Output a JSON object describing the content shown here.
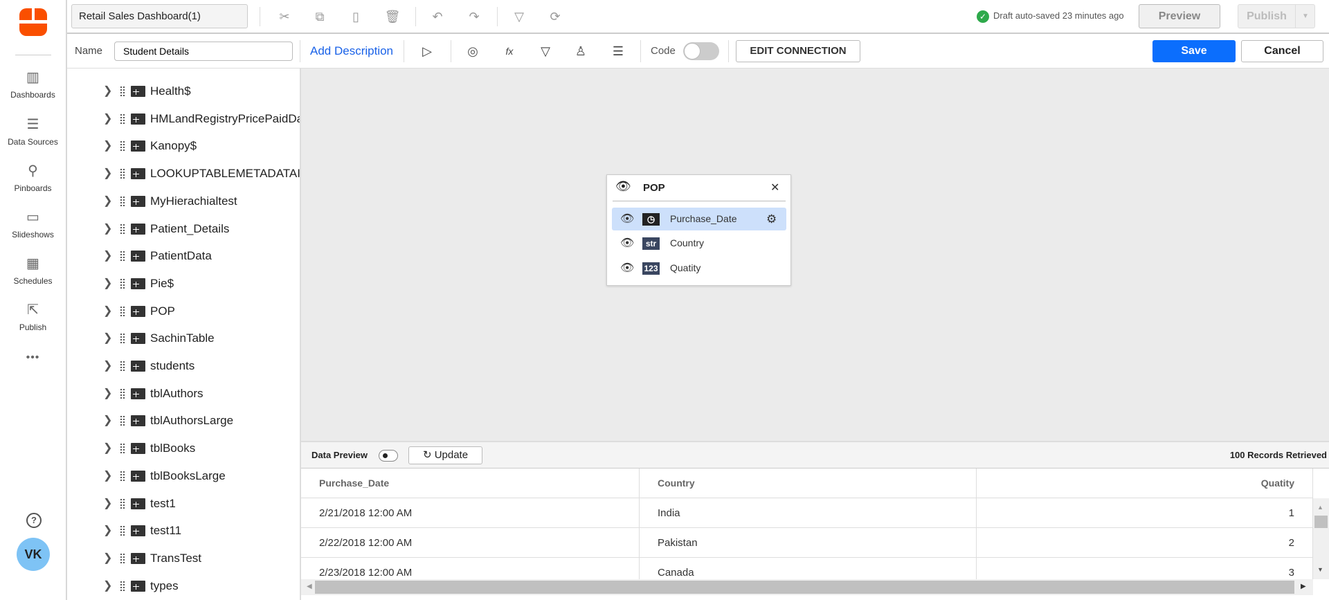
{
  "nav": {
    "items": [
      {
        "label": "Dashboards",
        "icon": "bar-chart-icon"
      },
      {
        "label": "Data Sources",
        "icon": "server-icon"
      },
      {
        "label": "Pinboards",
        "icon": "pin-icon"
      },
      {
        "label": "Slideshows",
        "icon": "tv-icon"
      },
      {
        "label": "Schedules",
        "icon": "calendar-clock-icon"
      },
      {
        "label": "Publish",
        "icon": "share-icon"
      }
    ],
    "more": "•••",
    "help": "?",
    "avatar": "VK"
  },
  "topbar": {
    "title": "Retail Sales Dashboard(1)",
    "status": "Draft auto-saved 23 minutes ago",
    "preview": "Preview",
    "publish": "Publish"
  },
  "toolbar": {
    "name_label": "Name",
    "name_value": "Student Details",
    "add_description": "Add Description",
    "code_label": "Code",
    "edit_connection": "EDIT CONNECTION",
    "save": "Save",
    "cancel": "Cancel"
  },
  "tree": {
    "items": [
      "Health$",
      "HMLandRegistryPricePaidDat",
      "Kanopy$",
      "LOOKUPTABLEMETADATAINF",
      "MyHierachialtest",
      "Patient_Details",
      "PatientData",
      "Pie$",
      "POP",
      "SachinTable",
      "students",
      "tblAuthors",
      "tblAuthorsLarge",
      "tblBooks",
      "tblBooksLarge",
      "test1",
      "test11",
      "TransTest",
      "types"
    ]
  },
  "popup": {
    "title": "POP",
    "fields": [
      {
        "type": "date",
        "badge": "",
        "name": "Purchase_Date"
      },
      {
        "type": "string",
        "badge": "str",
        "name": "Country"
      },
      {
        "type": "number",
        "badge": "123",
        "name": "Quatity"
      }
    ]
  },
  "preview": {
    "label": "Data Preview",
    "update": "Update",
    "records": "100 Records Retrieved"
  },
  "table": {
    "headers": [
      "Purchase_Date",
      "Country",
      "Quatity"
    ],
    "rows": [
      [
        "2/21/2018 12:00 AM",
        "India",
        "1"
      ],
      [
        "2/22/2018 12:00 AM",
        "Pakistan",
        "2"
      ],
      [
        "2/23/2018 12:00 AM",
        "Canada",
        "3"
      ]
    ]
  },
  "colors": {
    "accent": "#0b6efd",
    "logo": "#fa4f00",
    "selected": "#cde0fb",
    "success": "#2ea94b"
  }
}
